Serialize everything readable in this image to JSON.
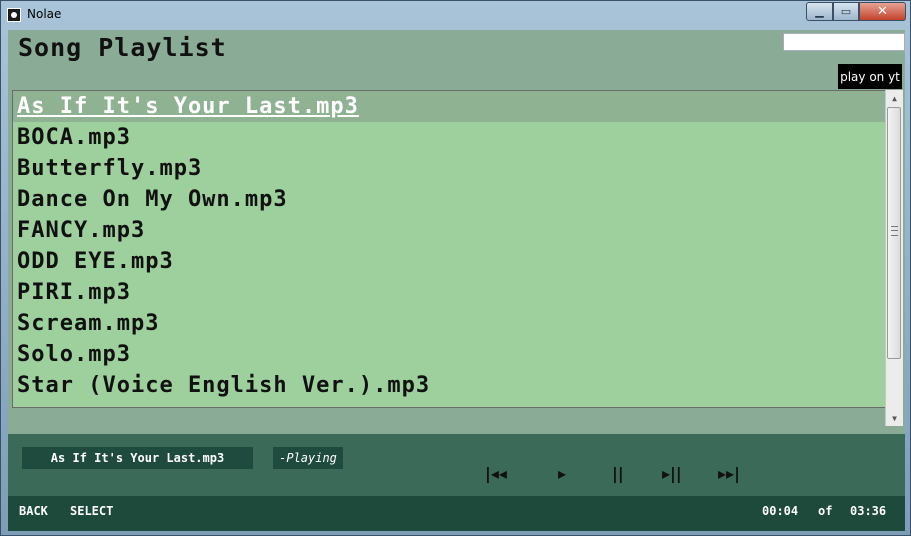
{
  "window": {
    "title": "Nolae"
  },
  "header": {
    "title": "Song Playlist",
    "search_value": ""
  },
  "youtube_button": {
    "label": "play on yt"
  },
  "playlist": {
    "items": [
      {
        "label": "As If It's Your Last.mp3",
        "selected": true
      },
      {
        "label": "BOCA.mp3"
      },
      {
        "label": "Butterfly.mp3"
      },
      {
        "label": "Dance On My Own.mp3"
      },
      {
        "label": "FANCY.mp3"
      },
      {
        "label": "ODD EYE.mp3"
      },
      {
        "label": "PIRI.mp3"
      },
      {
        "label": "Scream.mp3"
      },
      {
        "label": "Solo.mp3"
      },
      {
        "label": "Star (Voice English Ver.).mp3"
      }
    ]
  },
  "player": {
    "now_playing": "As If It's Your Last.mp3",
    "status": "-Playing",
    "buttons": {
      "prev": "|◂◂",
      "play": "▸",
      "pause": "||",
      "next": "▸||",
      "fast_forward": "▸▸|"
    }
  },
  "footer": {
    "back": "BACK",
    "select": "SELECT",
    "current_time": "00:04",
    "of": "of",
    "total_time": "03:36"
  },
  "colors": {
    "list_bg": "#9dd09d",
    "player_bg": "#3c6a58",
    "footer_bg": "#1e4a3c"
  }
}
